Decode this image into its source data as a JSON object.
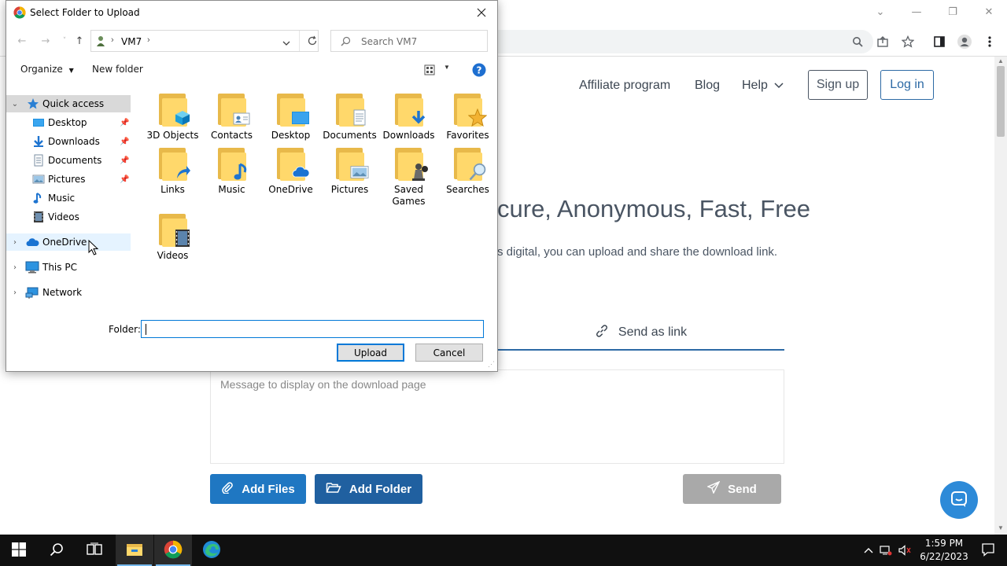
{
  "browser": {
    "window_controls": [
      "⌄",
      "—",
      "❐",
      "✕"
    ]
  },
  "website": {
    "nav": {
      "affiliate": "Affiliate program",
      "blog": "Blog",
      "help": "Help",
      "signup": "Sign up",
      "login": "Log in"
    },
    "hero_title": "cure, Anonymous, Fast, Free",
    "hero_subtitle": "s digital, you can upload and share the download link.",
    "send_as_link_tab": "Send as link",
    "message_placeholder": "Message to display on the download page",
    "add_files_label": "Add Files",
    "add_folder_label": "Add Folder",
    "send_label": "Send",
    "colors": {
      "accent": "#2d6aa5",
      "button_blue": "#1f77c2",
      "button_disabled": "#a9a9a9"
    }
  },
  "dialog": {
    "title": "Select Folder to Upload",
    "address": {
      "path": "VM7",
      "separator": "›"
    },
    "search_placeholder": "Search VM7",
    "commands": {
      "organize": "Organize",
      "new_folder": "New folder"
    },
    "nav_pane": {
      "quick_access": "Quick access",
      "quick_items": [
        {
          "label": "Desktop",
          "icon": "desktop-icon",
          "pinned": true
        },
        {
          "label": "Downloads",
          "icon": "downloads-icon",
          "pinned": true
        },
        {
          "label": "Documents",
          "icon": "documents-icon",
          "pinned": true
        },
        {
          "label": "Pictures",
          "icon": "pictures-icon",
          "pinned": true
        },
        {
          "label": "Music",
          "icon": "music-icon",
          "pinned": false
        },
        {
          "label": "Videos",
          "icon": "videos-icon",
          "pinned": false
        }
      ],
      "onedrive": "OneDrive",
      "this_pc": "This PC",
      "network": "Network"
    },
    "files": [
      {
        "label": "3D Objects",
        "icon": "3d-objects-folder-icon"
      },
      {
        "label": "Contacts",
        "icon": "contacts-folder-icon"
      },
      {
        "label": "Desktop",
        "icon": "desktop-folder-icon"
      },
      {
        "label": "Documents",
        "icon": "documents-folder-icon"
      },
      {
        "label": "Downloads",
        "icon": "downloads-folder-icon"
      },
      {
        "label": "Favorites",
        "icon": "favorites-folder-icon"
      },
      {
        "label": "Links",
        "icon": "links-folder-icon"
      },
      {
        "label": "Music",
        "icon": "music-folder-icon"
      },
      {
        "label": "OneDrive",
        "icon": "onedrive-folder-icon"
      },
      {
        "label": "Pictures",
        "icon": "pictures-folder-icon"
      },
      {
        "label": "Saved Games",
        "icon": "saved-games-folder-icon"
      },
      {
        "label": "Searches",
        "icon": "searches-folder-icon"
      },
      {
        "label": "Videos",
        "icon": "videos-folder-icon"
      }
    ],
    "folder_label": "Folder:",
    "folder_value": "",
    "upload_label": "Upload",
    "cancel_label": "Cancel"
  },
  "taskbar": {
    "time": "1:59 PM",
    "date": "6/22/2023"
  }
}
